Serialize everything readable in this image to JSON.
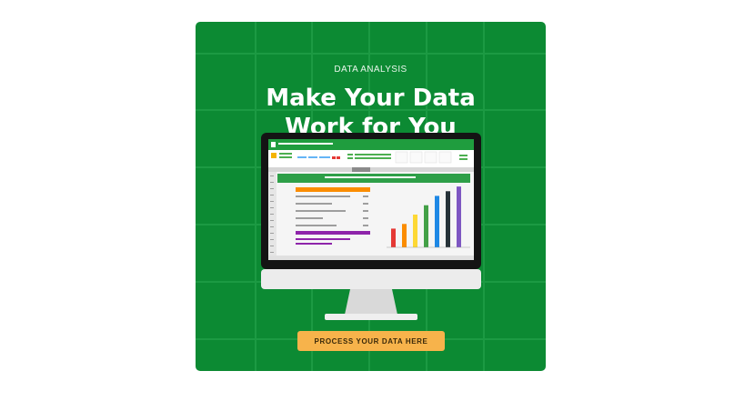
{
  "banner": {
    "eyebrow": "DATA ANALYSIS",
    "title_line1": "Make Your Data",
    "title_line2": "Work for You",
    "cta_label": "PROCESS YOUR DATA HERE"
  },
  "colors": {
    "background": "#0c8a33",
    "cta": "#f7b34b",
    "chart_bars": [
      "#e53935",
      "#fb8c00",
      "#fdd835",
      "#43a047",
      "#1e88e5",
      "#263238",
      "#7e57c2"
    ]
  },
  "chart_data": {
    "type": "bar",
    "values": [
      2,
      2.5,
      3.5,
      4.5,
      5.5,
      6,
      6.5
    ],
    "ylim": [
      0,
      7
    ]
  }
}
